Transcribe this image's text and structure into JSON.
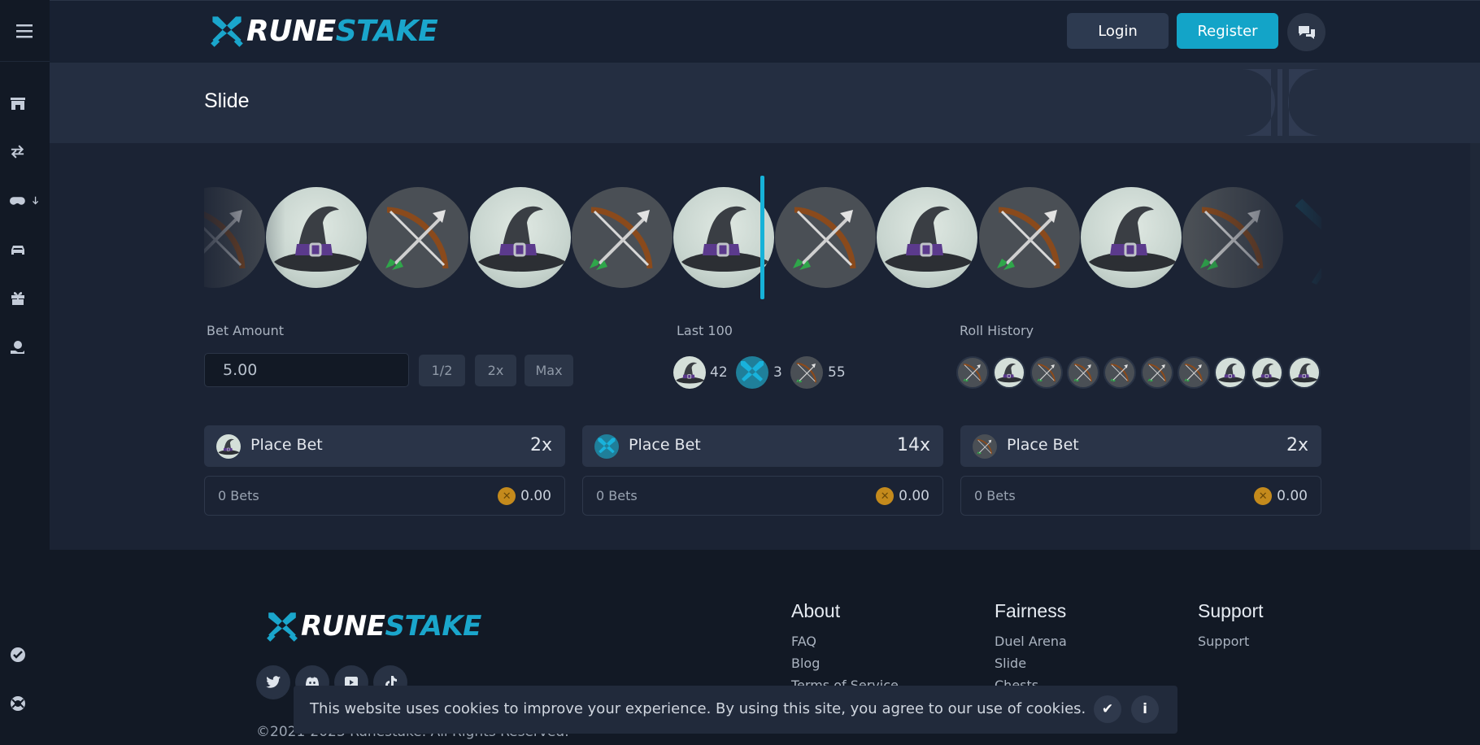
{
  "brand": {
    "name_part1": "RUNE",
    "name_part2": "STAKE",
    "accent": "#13a4c8"
  },
  "header": {
    "login_label": "Login",
    "register_label": "Register"
  },
  "sidebar": {
    "icons": [
      "menu-icon",
      "shop-icon",
      "exchange-icon",
      "gamepad-icon",
      "car-icon",
      "gift-icon",
      "money-hand-icon",
      "verified-icon",
      "support-icon"
    ]
  },
  "page": {
    "title": "Slide"
  },
  "roller": {
    "tiles": [
      "bow",
      "witch",
      "bow",
      "witch",
      "bow",
      "witch",
      "bow",
      "witch",
      "bow",
      "witch",
      "bow"
    ]
  },
  "bet": {
    "label": "Bet Amount",
    "value": "5.00",
    "half_label": "1/2",
    "double_label": "2x",
    "max_label": "Max"
  },
  "last100": {
    "label": "Last 100",
    "witch_count": "42",
    "x_count": "3",
    "bow_count": "55"
  },
  "history": {
    "label": "Roll History",
    "items": [
      "bow",
      "witch",
      "bow",
      "bow",
      "bow",
      "bow",
      "bow",
      "witch",
      "witch",
      "witch"
    ]
  },
  "panels": [
    {
      "icon": "witch",
      "label": "Place Bet",
      "multiplier": "2x",
      "bets": "0 Bets",
      "amount": "0.00"
    },
    {
      "icon": "x",
      "label": "Place Bet",
      "multiplier": "14x",
      "bets": "0 Bets",
      "amount": "0.00"
    },
    {
      "icon": "bow",
      "label": "Place Bet",
      "multiplier": "2x",
      "bets": "0 Bets",
      "amount": "0.00"
    }
  ],
  "footer": {
    "about": {
      "heading": "About",
      "links": [
        "FAQ",
        "Blog",
        "Terms of Service"
      ]
    },
    "fairness": {
      "heading": "Fairness",
      "links": [
        "Duel Arena",
        "Slide",
        "Chests"
      ]
    },
    "support": {
      "heading": "Support",
      "links": [
        "Support"
      ]
    },
    "copyright": "©2021-2023 Runestake. All Rights Reserved."
  },
  "cookie": {
    "text": "This website uses cookies to improve your experience. By using this site, you agree to our use of cookies."
  }
}
